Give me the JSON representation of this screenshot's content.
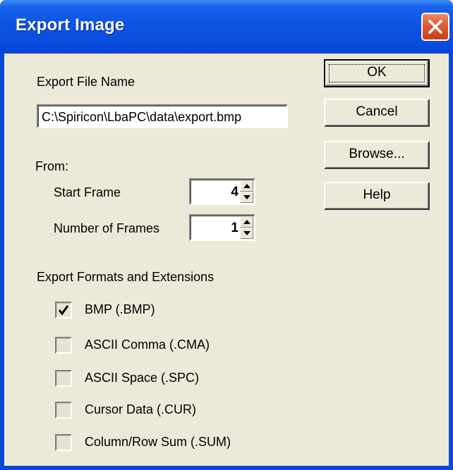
{
  "window": {
    "title": "Export Image"
  },
  "export_file": {
    "label": "Export File Name",
    "value": "C:\\Spiricon\\LbaPC\\data\\export.bmp"
  },
  "from": {
    "label": "From:",
    "start_frame": {
      "label": "Start Frame",
      "value": "4"
    },
    "number_of_frames": {
      "label": "Number of Frames",
      "value": "1"
    }
  },
  "formats": {
    "label": "Export Formats and Extensions",
    "items": [
      {
        "label": "BMP (.BMP)",
        "checked": true
      },
      {
        "label": "ASCII Comma (.CMA)",
        "checked": false
      },
      {
        "label": "ASCII Space (.SPC)",
        "checked": false
      },
      {
        "label": "Cursor Data (.CUR)",
        "checked": false
      },
      {
        "label": "Column/Row Sum (.SUM)",
        "checked": false
      }
    ]
  },
  "buttons": {
    "ok": "OK",
    "cancel": "Cancel",
    "browse": "Browse...",
    "help": "Help"
  },
  "colors": {
    "title_bar": "#0a4ee0",
    "close_button": "#e05a30",
    "dialog_face": "#ece9d8"
  },
  "icons": {
    "close": "close-icon",
    "spin_up": "spin-up-arrow-icon",
    "spin_down": "spin-down-arrow-icon",
    "check": "checkmark-icon"
  }
}
